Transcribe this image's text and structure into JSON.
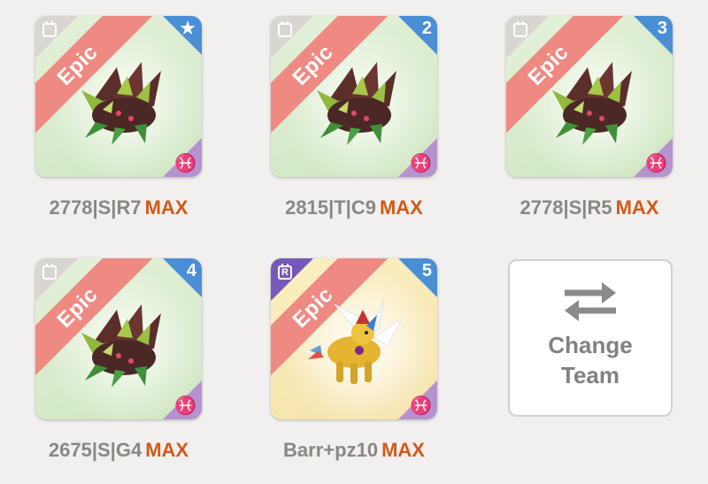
{
  "team": {
    "slots": [
      {
        "rarity": "Epic",
        "badge": "★",
        "badge_icon": "star-icon",
        "code": "2778|S|R7",
        "level": "MAX",
        "element": "♓",
        "corner": "gray",
        "bg": "green"
      },
      {
        "rarity": "Epic",
        "badge": "2",
        "code": "2815|T|C9",
        "level": "MAX",
        "element": "♓",
        "corner": "gray",
        "bg": "green"
      },
      {
        "rarity": "Epic",
        "badge": "3",
        "code": "2778|S|R5",
        "level": "MAX",
        "element": "♓",
        "corner": "gray",
        "bg": "green"
      },
      {
        "rarity": "Epic",
        "badge": "4",
        "code": "2675|S|G4",
        "level": "MAX",
        "element": "♓",
        "corner": "gray",
        "bg": "green"
      },
      {
        "rarity": "Epic",
        "badge": "5",
        "code": "Barr+pz10",
        "level": "MAX",
        "element": "♓",
        "corner": "purple",
        "corner_letter": "R",
        "bg": "yellow"
      }
    ],
    "change_team": {
      "line1": "Change",
      "line2": "Team",
      "icon": "swap-arrows-icon"
    }
  },
  "colors": {
    "max": "#d05a1b",
    "epic_ribbon": "#ee8a82",
    "badge_blue": "#4a8fd6",
    "element_purple": "#b493cf",
    "label_gray": "#8a8784"
  }
}
